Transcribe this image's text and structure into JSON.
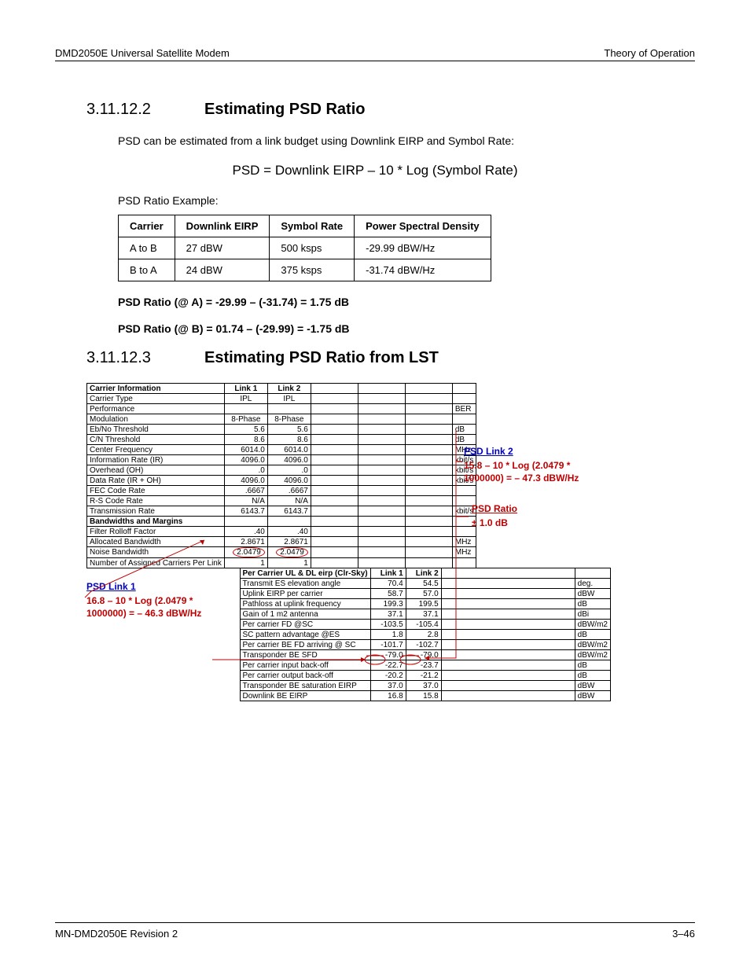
{
  "header": {
    "left": "DMD2050E Universal Satellite Modem",
    "right": "Theory of Operation"
  },
  "section1": {
    "num": "3.11.12.2",
    "title": "Estimating PSD Ratio",
    "intro": "PSD can be estimated from a link budget using Downlink EIRP and Symbol Rate:",
    "formula": "PSD = Downlink EIRP – 10 * Log (Symbol Rate)",
    "example_label": "PSD Ratio Example:",
    "table": {
      "headers": [
        "Carrier",
        "Downlink EIRP",
        "Symbol Rate",
        "Power Spectral Density"
      ],
      "rows": [
        [
          "A to B",
          "27 dBW",
          "500 ksps",
          "-29.99 dBW/Hz"
        ],
        [
          "B to A",
          "24 dBW",
          "375 ksps",
          "-31.74 dBW/Hz"
        ]
      ]
    },
    "ratio_a": "PSD Ratio (@ A) = -29.99 – (-31.74) = 1.75 dB",
    "ratio_b": "PSD Ratio (@ B) = 01.74 – (-29.99) = -1.75 dB"
  },
  "section2": {
    "num": "3.11.12.3",
    "title": "Estimating PSD Ratio from LST"
  },
  "lst": {
    "header_row": [
      "Carrier Information",
      "Link 1",
      "Link 2",
      "",
      "",
      "",
      ""
    ],
    "rows_top": [
      [
        "Carrier Type",
        "IPL",
        "IPL",
        "",
        "",
        "",
        ""
      ],
      [
        "Performance",
        "",
        "",
        "",
        "",
        "",
        "BER"
      ],
      [
        "Modulation",
        "8-Phase",
        "8-Phase",
        "",
        "",
        "",
        ""
      ],
      [
        "Eb/No Threshold",
        "5.6",
        "5.6",
        "",
        "",
        "",
        "dB"
      ],
      [
        "C/N Threshold",
        "8.6",
        "8.6",
        "",
        "",
        "",
        "dB"
      ],
      [
        "Center Frequency",
        "6014.0",
        "6014.0",
        "",
        "",
        "",
        "MHz"
      ],
      [
        "Information Rate (IR)",
        "4096.0",
        "4096.0",
        "",
        "",
        "",
        "kbit/s"
      ],
      [
        "Overhead (OH)",
        ".0",
        ".0",
        "",
        "",
        "",
        "kbit/s"
      ],
      [
        "Data Rate (IR + OH)",
        "4096.0",
        "4096.0",
        "",
        "",
        "",
        "kbit/s"
      ],
      [
        "FEC Code Rate",
        ".6667",
        ".6667",
        "",
        "",
        "",
        ""
      ],
      [
        "R-S Code Rate",
        "N/A",
        "N/A",
        "",
        "",
        "",
        ""
      ],
      [
        "Transmission Rate",
        "6143.7",
        "6143.7",
        "",
        "",
        "",
        "kbit/s"
      ]
    ],
    "bandwidths_header": "Bandwidths and Margins",
    "rows_bw": [
      [
        "Filter Rolloff Factor",
        ".40",
        ".40",
        "",
        "",
        "",
        ""
      ],
      [
        "Allocated Bandwidth",
        "2.8671",
        "2.8671",
        "",
        "",
        "",
        "MHz"
      ],
      [
        "Noise Bandwidth",
        "2.0479",
        "2.0479",
        "",
        "",
        "",
        "MHz"
      ],
      [
        "Number of Assigned Carriers Per Link",
        "1",
        "1",
        "",
        "",
        "",
        ""
      ]
    ],
    "eirp_header": [
      "Per Carrier UL & DL eirp (Clr-Sky)",
      "Link 1",
      "Link 2",
      "",
      ""
    ],
    "rows_eirp": [
      [
        "Transmit ES elevation angle",
        "70.4",
        "54.5",
        "",
        "deg."
      ],
      [
        "Uplink EIRP per carrier",
        "58.7",
        "57.0",
        "",
        "dBW"
      ],
      [
        "Pathloss at uplink frequency",
        "199.3",
        "199.5",
        "",
        "dB"
      ],
      [
        "Gain of 1 m2 antenna",
        "37.1",
        "37.1",
        "",
        "dBi"
      ],
      [
        "Per carrier FD @SC",
        "-103.5",
        "-105.4",
        "",
        "dBW/m2"
      ],
      [
        "SC pattern advantage @ES",
        "1.8",
        "2.8",
        "",
        "dB"
      ],
      [
        "Per carrier BE FD arriving @ SC",
        "-101.7",
        "-102.7",
        "",
        "dBW/m2"
      ],
      [
        "Transponder BE SFD",
        "-79.0",
        "-79.0",
        "",
        "dBW/m2"
      ],
      [
        "Per carrier input back-off",
        "-22.7",
        "-23.7",
        "",
        "dB"
      ],
      [
        "Per carrier output back-off",
        "-20.2",
        "-21.2",
        "",
        "dB"
      ],
      [
        "Transponder BE saturation EIRP",
        "37.0",
        "37.0",
        "",
        "dBW"
      ],
      [
        "Downlink BE EIRP",
        "16.8",
        "15.8",
        "",
        "dBW"
      ]
    ]
  },
  "notes": {
    "link1_title": "PSD Link 1",
    "link1_calc": "16.8 – 10 * Log (2.0479 * 1000000) =  – 46.3 dBW/Hz",
    "link2_title": "PSD Link 2",
    "link2_calc": "15.8 – 10 * Log (2.0479 * 1000000) =  – 47.3 dBW/Hz",
    "ratio_title": "PSD Ratio",
    "ratio_val": "± 1.0 dB"
  },
  "footer": {
    "left": "MN-DMD2050E    Revision 2",
    "right": "3–46"
  }
}
